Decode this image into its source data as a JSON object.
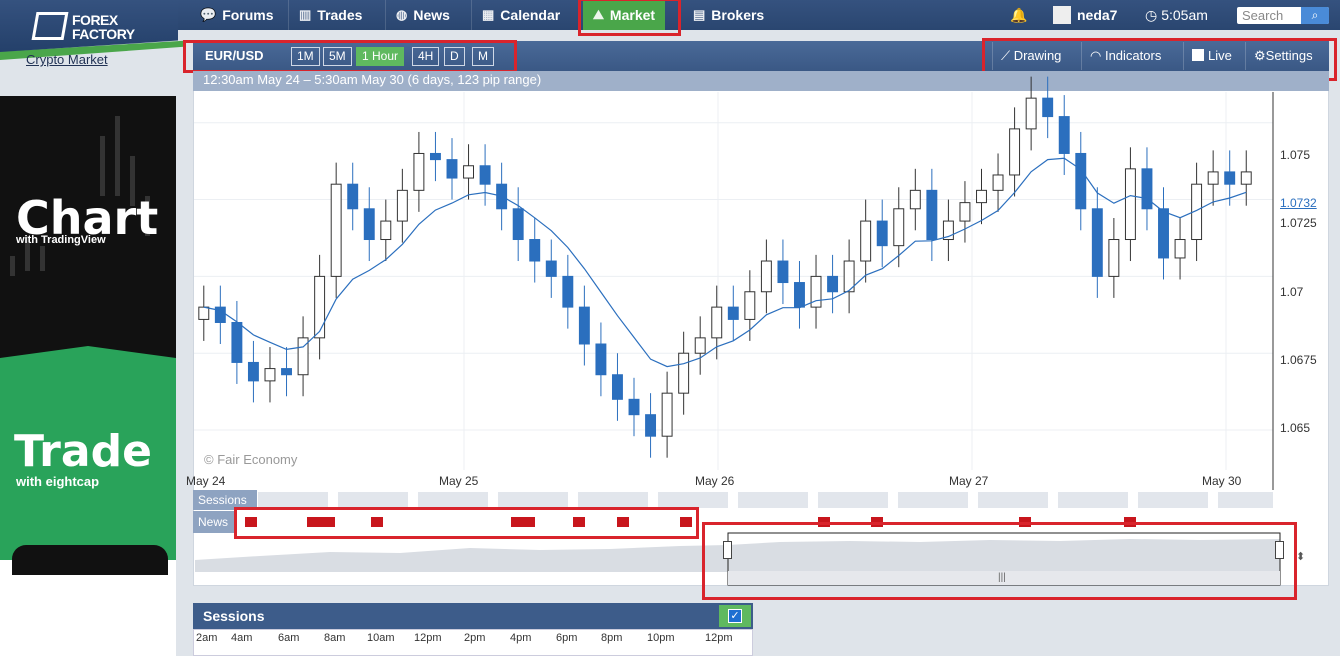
{
  "brand": {
    "line1": "FOREX",
    "line2": "FACTORY"
  },
  "nav": {
    "items": [
      {
        "label": "Forums",
        "icon": "speech-bubbles-icon"
      },
      {
        "label": "Trades",
        "icon": "bar-chart-icon"
      },
      {
        "label": "News",
        "icon": "globe-icon"
      },
      {
        "label": "Calendar",
        "icon": "calendar-icon"
      },
      {
        "label": "Market",
        "icon": "market-chart-icon",
        "active": true
      },
      {
        "label": "Brokers",
        "icon": "building-icon"
      }
    ]
  },
  "header": {
    "username": "neda7",
    "time": "5:05am",
    "search_placeholder": "Search"
  },
  "sidebar": {
    "link": "Crypto Market"
  },
  "ad": {
    "word1": "Chart",
    "with1": "with TradingView",
    "word2": "Trade",
    "with2": "with eightcap"
  },
  "chart_toolbar": {
    "pair": "EUR/USD",
    "timeframes": [
      "1M",
      "5M",
      "1 Hour",
      "4H",
      "D",
      "M"
    ],
    "active_timeframe": "1 Hour",
    "tools": [
      "Drawing",
      "Indicators",
      "Live",
      "Settings"
    ]
  },
  "chart_info": {
    "range": "12:30am May 24 – 5:30am May 30 (6 days, 123 pip range)",
    "watermark": "© Fair Economy"
  },
  "chart_data": {
    "type": "line",
    "title": "",
    "xlabel": "",
    "ylabel": "",
    "x_ticks": [
      "May 24",
      "May 25",
      "May 26",
      "May 27",
      "May 30"
    ],
    "y_ticks": [
      1.065,
      1.0675,
      1.07,
      1.0725,
      1.075
    ],
    "ylim": [
      1.0637,
      1.076
    ],
    "current_price": "1.0732",
    "series": [
      {
        "values": [
          1.069,
          1.0685,
          1.0672,
          1.0666,
          1.067,
          1.0668,
          1.068,
          1.07,
          1.073,
          1.0722,
          1.0712,
          1.0718,
          1.0728,
          1.074,
          1.0738,
          1.0732,
          1.0736,
          1.073,
          1.0722,
          1.0712,
          1.0705,
          1.07,
          1.069,
          1.0678,
          1.0668,
          1.066,
          1.0655,
          1.0648,
          1.0662,
          1.0675,
          1.068,
          1.069,
          1.0686,
          1.0695,
          1.0705,
          1.0698,
          1.069,
          1.07,
          1.0695,
          1.0705,
          1.0718,
          1.071,
          1.0722,
          1.0728,
          1.0712,
          1.0718,
          1.0724,
          1.0728,
          1.0733,
          1.0748,
          1.0758,
          1.0752,
          1.074,
          1.0722,
          1.07,
          1.0712,
          1.0735,
          1.0722,
          1.0706,
          1.0712,
          1.073,
          1.0734,
          1.073,
          1.0734
        ]
      }
    ]
  },
  "chart_lower": {
    "sessions_label": "Sessions",
    "news_label": "News"
  },
  "sessions_panel": {
    "title": "Sessions",
    "times": [
      "2am",
      "4am",
      "6am",
      "8am",
      "10am",
      "12pm",
      "2pm",
      "4pm",
      "6pm",
      "8pm",
      "10pm",
      "12pm"
    ]
  },
  "colors": {
    "nav_bg": "#35527f",
    "active_green": "#4aa64a",
    "candle_down": "#2b6fbe",
    "ma_line": "#2b6fbe",
    "highlight_red": "#d9242c"
  }
}
